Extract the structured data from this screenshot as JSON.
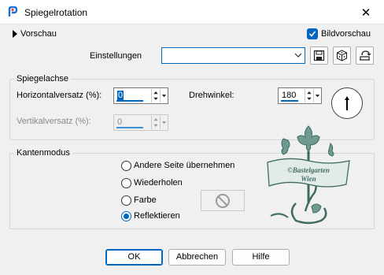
{
  "window": {
    "title": "Spiegelrotation",
    "close_glyph": "✕"
  },
  "preview": {
    "toggle_label": "Vorschau",
    "bildvorschau_label": "Bildvorschau",
    "bildvorschau_checked": true
  },
  "settings": {
    "label": "Einstellungen",
    "value": ""
  },
  "spiegelachse": {
    "group_label": "Spiegelachse",
    "horizontal_label": "Horizontalversatz (%):",
    "horizontal_value": "0",
    "vertikal_label": "Vertikalversatz (%):",
    "vertikal_value": "0",
    "drehwinkel_label": "Drehwinkel:",
    "drehwinkel_value": "180"
  },
  "kantenmodus": {
    "group_label": "Kantenmodus",
    "options": [
      {
        "label": "Andere Seite übernehmen",
        "checked": false
      },
      {
        "label": "Wiederholen",
        "checked": false
      },
      {
        "label": "Farbe",
        "checked": false
      },
      {
        "label": "Reflektieren",
        "checked": true
      }
    ]
  },
  "watermark": {
    "line1": "©Bastelgarten",
    "line2": "Wien"
  },
  "buttons": {
    "ok": "OK",
    "cancel": "Abbrechen",
    "help": "Hilfe"
  },
  "colors": {
    "accent": "#0067c0",
    "watermark": "#4d7a72"
  }
}
